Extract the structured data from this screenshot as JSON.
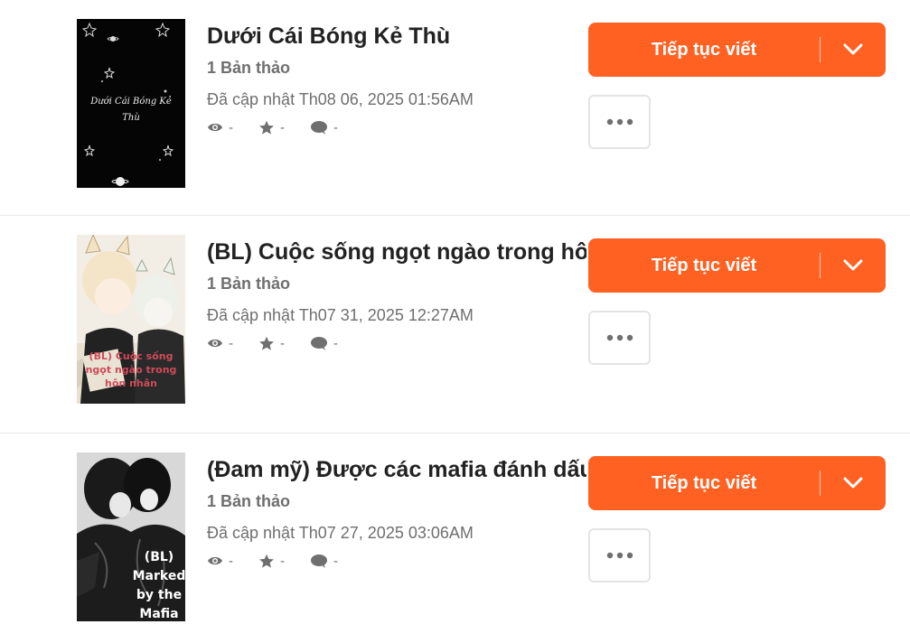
{
  "stories": [
    {
      "title": "Dưới Cái Bóng Kẻ Thù",
      "drafts": "1 Bản thảo",
      "updated": "Đã cập nhật Th08 06, 2025 01:56AM",
      "views": "-",
      "votes": "-",
      "comments": "-",
      "cover_text": [
        "Dưới Cái Bóng Kẻ",
        "Thù"
      ],
      "continue_label": "Tiếp tục viết"
    },
    {
      "title": "(BL) Cuộc sống ngọt ngào trong hôn nhân",
      "drafts": "1 Bản thảo",
      "updated": "Đã cập nhật Th07 31, 2025 12:27AM",
      "views": "-",
      "votes": "-",
      "comments": "-",
      "cover_text": [
        "(BL) Cuộc sống",
        "ngọt ngào trong",
        "hôn nhân"
      ],
      "continue_label": "Tiếp tục viết"
    },
    {
      "title": "(Đam mỹ) Được các mafia đánh dấu",
      "drafts": "1 Bản thảo",
      "updated": "Đã cập nhật Th07 27, 2025 03:06AM",
      "views": "-",
      "votes": "-",
      "comments": "-",
      "cover_text": [
        "(BL)",
        "Marked",
        "by the",
        "Mafia"
      ],
      "continue_label": "Tiếp tục viết"
    }
  ],
  "icons": {
    "views": "eye-icon",
    "votes": "star-icon",
    "comments": "comment-icon",
    "dropdown": "chevron-down-icon",
    "more": "more-dots-icon"
  },
  "colors": {
    "accent": "#ff6122",
    "muted_text": "#6f6f6f",
    "title_text": "#222222"
  }
}
